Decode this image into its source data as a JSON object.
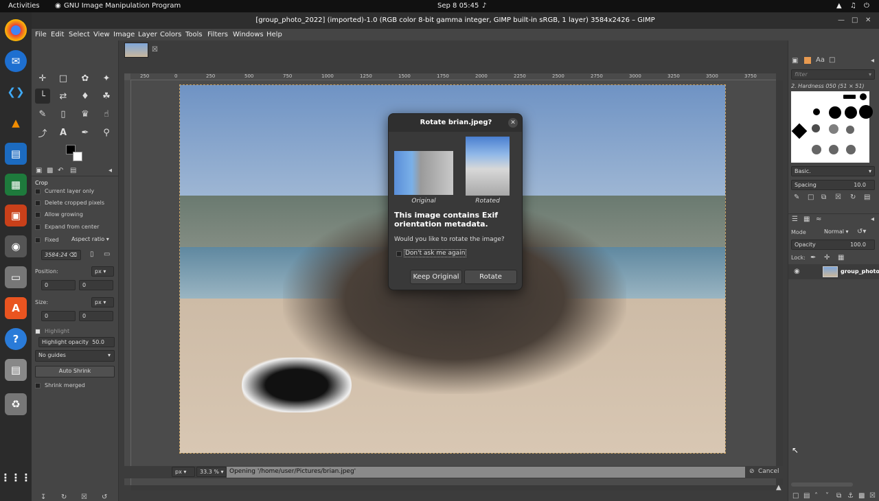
{
  "topbar": {
    "activities": "Activities",
    "app": "GNU Image Manipulation Program",
    "clock": "Sep 8  05:45"
  },
  "window": {
    "title": "[group_photo_2022] (imported)-1.0 (RGB color 8-bit gamma integer, GIMP built-in sRGB, 1 layer) 3584x2426 – GIMP"
  },
  "menu": [
    "File",
    "Edit",
    "Select",
    "View",
    "Image",
    "Layer",
    "Colors",
    "Tools",
    "Filters",
    "Windows",
    "Help"
  ],
  "tool_options": {
    "title": "Crop",
    "current_layer_only": "Current layer only",
    "delete_cropped": "Delete cropped pixels",
    "allow_growing": "Allow growing",
    "expand_center": "Expand from center",
    "fixed": "Fixed",
    "aspect": "Aspect ratio",
    "ratio_value": "3584:24",
    "position_label": "Position:",
    "size_label": "Size:",
    "unit": "px",
    "pos_x": "0",
    "pos_y": "0",
    "size_w": "0",
    "size_h": "0",
    "highlight": "Highlight",
    "highlight_opacity": "Highlight opacity",
    "highlight_opacity_value": "50.0",
    "guides": "No guides",
    "auto_shrink": "Auto Shrink",
    "shrink_merged": "Shrink merged"
  },
  "ruler_ticks": [
    "250",
    "0",
    "250",
    "500",
    "750",
    "1000",
    "1250",
    "1500",
    "1750",
    "2000",
    "2250",
    "2500",
    "2750",
    "3000",
    "3250",
    "3500",
    "3750"
  ],
  "status": {
    "unit": "px",
    "zoom": "33.3 %",
    "message": "Opening '/home/user/Pictures/brian.jpeg'",
    "cancel": "Cancel"
  },
  "brushes": {
    "filter_placeholder": "filter",
    "current": "2. Hardness 050 (51 × 51)",
    "set": "Basic.",
    "spacing_label": "Spacing",
    "spacing_value": "10.0"
  },
  "layers": {
    "mode_label": "Mode",
    "mode_value": "Normal",
    "opacity_label": "Opacity",
    "opacity_value": "100.0",
    "lock_label": "Lock:",
    "layer_name": "group_photo_"
  },
  "dialog": {
    "title": "Rotate brian.jpeg?",
    "original": "Original",
    "rotated": "Rotated",
    "heading": "This image contains Exif orientation metadata.",
    "question": "Would you like to rotate the image?",
    "dont_ask": "Don't ask me again",
    "keep": "Keep Original",
    "rotate": "Rotate"
  },
  "colors": {
    "accent": "#4a4a4a",
    "selection": "#c8a060"
  }
}
